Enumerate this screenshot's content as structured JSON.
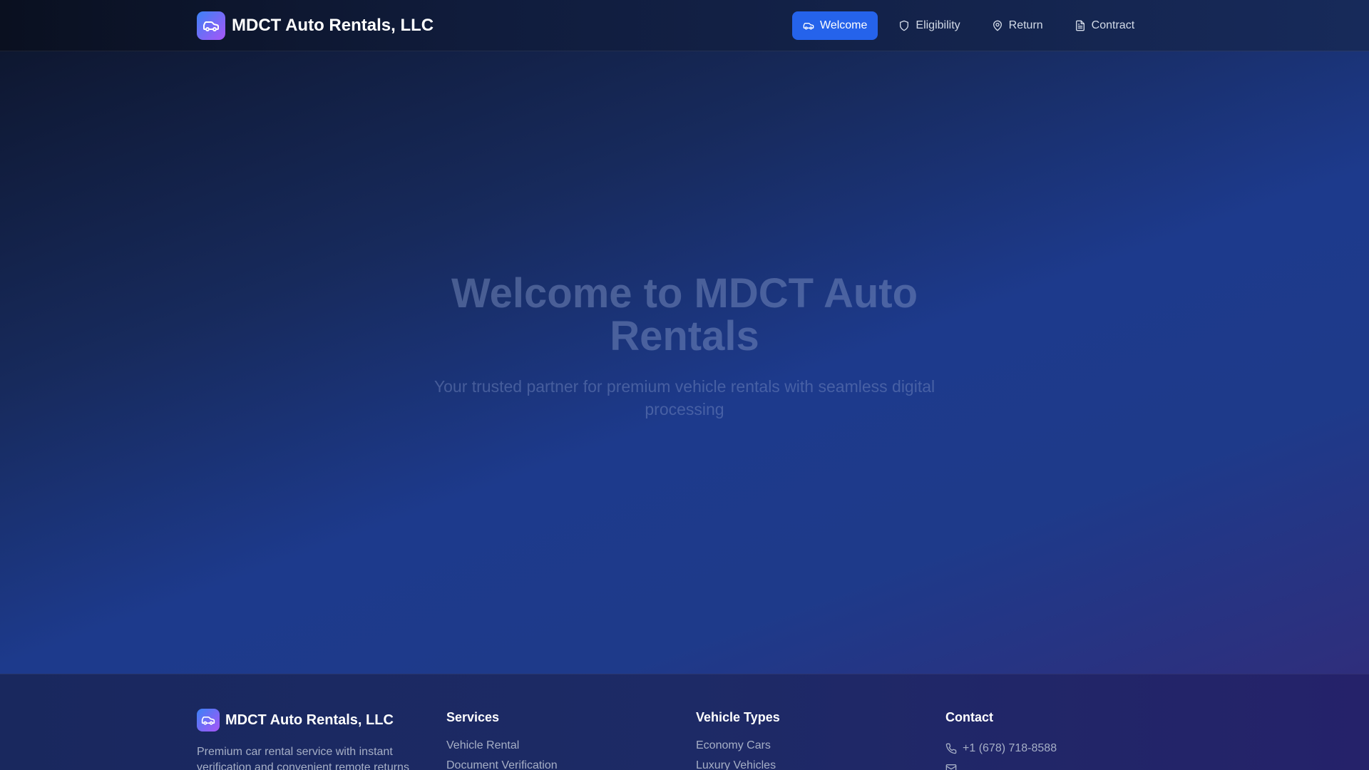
{
  "header": {
    "brand_title": "MDCT Auto Rentals, LLC",
    "logo_icon": "car-icon",
    "nav": [
      {
        "label": "Welcome",
        "icon": "car-icon",
        "active": true
      },
      {
        "label": "Eligibility",
        "icon": "shield-icon",
        "active": false
      },
      {
        "label": "Return",
        "icon": "map-pin-icon",
        "active": false
      },
      {
        "label": "Contract",
        "icon": "document-icon",
        "active": false
      }
    ]
  },
  "hero": {
    "title": "Welcome to MDCT Auto Rentals",
    "subtitle": "Your trusted partner for premium vehicle rentals with seamless digital processing"
  },
  "footer": {
    "brand_title": "MDCT Auto Rentals, LLC",
    "description": "Premium car rental service with instant verification and convenient remote returns",
    "services": {
      "heading": "Services",
      "items": [
        "Vehicle Rental",
        "Document Verification"
      ]
    },
    "vehicle_types": {
      "heading": "Vehicle Types",
      "items": [
        "Economy Cars",
        "Luxury Vehicles"
      ]
    },
    "contact": {
      "heading": "Contact",
      "phone": "+1 (678) 718-8588",
      "phone_icon": "phone-icon",
      "email_icon": "mail-icon"
    }
  },
  "colors": {
    "accent": "#2563eb",
    "logo_gradient_start": "#3b82f6",
    "logo_gradient_end": "#a855f7"
  }
}
